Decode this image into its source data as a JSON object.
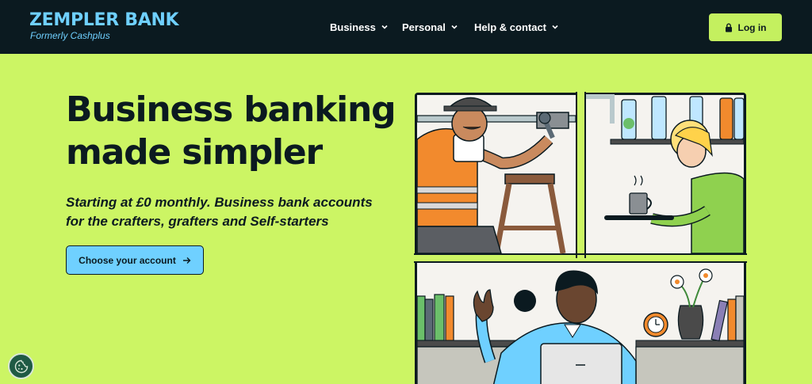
{
  "brand": {
    "name": "ZEMPLER BANK",
    "tagline": "Formerly Cashplus"
  },
  "nav": {
    "items": [
      {
        "label": "Business"
      },
      {
        "label": "Personal"
      },
      {
        "label": "Help & contact"
      }
    ],
    "login_label": "Log in"
  },
  "hero": {
    "title": "Business banking made simpler",
    "subtitle": "Starting at £0 monthly. Business bank accounts for the crafters, grafters and Self-starters",
    "cta_label": "Choose your account"
  },
  "colors": {
    "background": "#ccf564",
    "header": "#0b1a20",
    "brand_blue": "#6fd0ff",
    "login_button": "#c4f05f"
  },
  "icons": [
    "chevron-down-icon",
    "lock-icon",
    "arrow-right-icon",
    "cookie-icon"
  ]
}
